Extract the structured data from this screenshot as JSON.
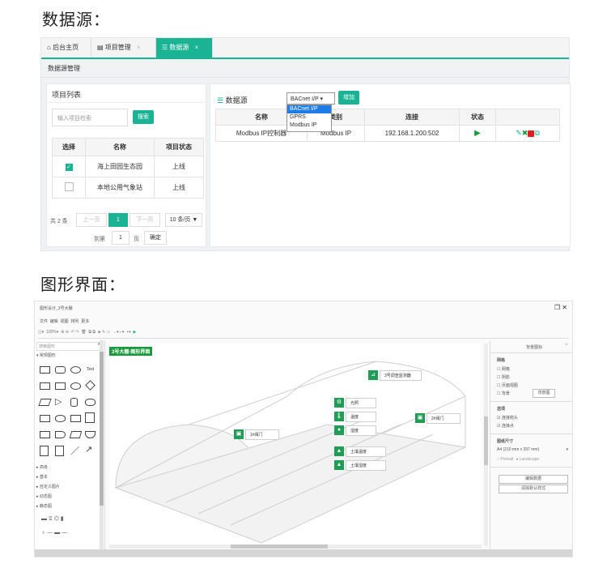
{
  "sections": {
    "data_source_title": "数据源：",
    "graphic_title": "图形界面："
  },
  "tabs": [
    {
      "label": "后台主页",
      "icon": "home-icon"
    },
    {
      "label": "项目管理",
      "icon": "grid-icon",
      "close": "×"
    },
    {
      "label": "数据源",
      "icon": "database-icon",
      "close": "×"
    }
  ],
  "breadcrumb": "数据源管理",
  "project_list": {
    "title": "项目列表",
    "search_placeholder": "输入项目检索",
    "search_button": "搜索",
    "columns": [
      "选择",
      "名称",
      "项目状态"
    ],
    "rows": [
      {
        "checked": true,
        "name": "海上田园生态园",
        "status": "上线"
      },
      {
        "checked": false,
        "name": "本地公用气象站",
        "status": "上线"
      }
    ],
    "pager": {
      "total": "共 2 条",
      "prev": "上一页",
      "page": "1",
      "next": "下一页",
      "per_page": "10 条/页 ▼",
      "goto": "到第",
      "goto_value": "1",
      "page_unit": "页",
      "confirm": "确定"
    }
  },
  "datasource": {
    "title": "数据源",
    "select_value": "BACnet I/P ▾",
    "add_button": "增加",
    "dropdown_options": [
      "BACnet I/P",
      "GPRS",
      "Modbus IP"
    ],
    "columns": [
      "名称",
      "类别",
      "连接",
      "状态",
      ""
    ],
    "rows": [
      {
        "name": "Modbus IP控制器",
        "type": "Modbus IP",
        "connection": "192.168.1.200:502",
        "status": "running"
      }
    ],
    "colors": {
      "accent": "#1ab394",
      "play": "#1a9a3c",
      "delete": "#e02020"
    }
  },
  "editor": {
    "window_title": "图形设计_3号大棚",
    "menu": [
      "文件",
      "编辑",
      "视图",
      "排列",
      "更多"
    ],
    "zoom": "100%",
    "search_placeholder": "搜索图形",
    "palette_general": "▾ 常规图形",
    "shape_text": "Text",
    "palettes": [
      "▸ 高级",
      "▸ 基本",
      "▸ 自定义图片",
      "▸ 动态图",
      "▸ 静态图"
    ],
    "page_tab": "3号大棚-图形界面",
    "devices": [
      {
        "label": "3号调查监测器",
        "icon": "sensor-icon"
      },
      {
        "label": "光照",
        "icon": "gear-icon"
      },
      {
        "label": "温度",
        "icon": "thermometer-icon"
      },
      {
        "label": "湿度",
        "icon": "drop-icon"
      },
      {
        "label": "1#阀门",
        "icon": "valve-icon"
      },
      {
        "label": "2#阀门",
        "icon": "valve-icon"
      },
      {
        "label": "土壤温度",
        "icon": "soil-icon"
      },
      {
        "label": "土壤湿度",
        "icon": "soil-icon"
      }
    ],
    "right_panel": {
      "title": "背景图标",
      "grid_section": "网格",
      "grid_options": [
        "网格",
        "阴影",
        "页面视图",
        "背景"
      ],
      "bg_button": "背景图",
      "options_section": "选项",
      "options": [
        "连接箭头",
        "连接点"
      ],
      "paper_section": "图纸尺寸",
      "paper_size": "A4 (210 mm x 297 mm)",
      "portrait": "Portrait",
      "landscape": "Landscape",
      "edit_data": "编辑数据",
      "clear_style": "清除默认样式"
    }
  }
}
